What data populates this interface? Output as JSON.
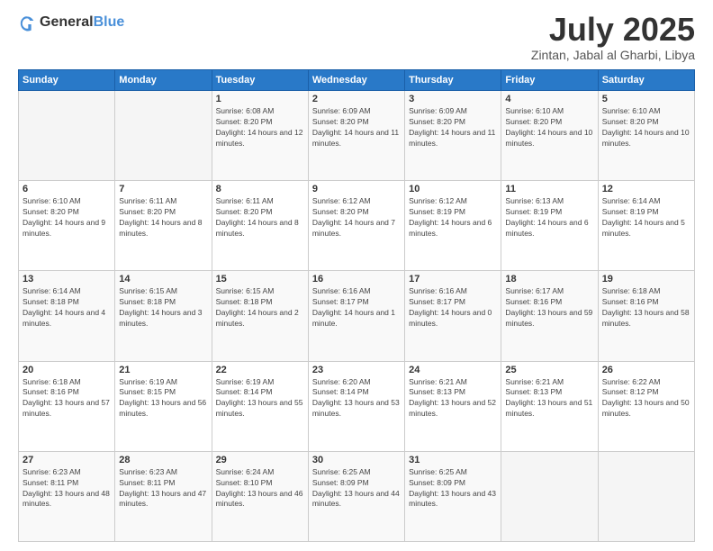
{
  "logo": {
    "general": "General",
    "blue": "Blue"
  },
  "title": {
    "month": "July 2025",
    "location": "Zintan, Jabal al Gharbi, Libya"
  },
  "header_days": [
    "Sunday",
    "Monday",
    "Tuesday",
    "Wednesday",
    "Thursday",
    "Friday",
    "Saturday"
  ],
  "weeks": [
    [
      {
        "day": "",
        "info": ""
      },
      {
        "day": "",
        "info": ""
      },
      {
        "day": "1",
        "info": "Sunrise: 6:08 AM\nSunset: 8:20 PM\nDaylight: 14 hours and 12 minutes."
      },
      {
        "day": "2",
        "info": "Sunrise: 6:09 AM\nSunset: 8:20 PM\nDaylight: 14 hours and 11 minutes."
      },
      {
        "day": "3",
        "info": "Sunrise: 6:09 AM\nSunset: 8:20 PM\nDaylight: 14 hours and 11 minutes."
      },
      {
        "day": "4",
        "info": "Sunrise: 6:10 AM\nSunset: 8:20 PM\nDaylight: 14 hours and 10 minutes."
      },
      {
        "day": "5",
        "info": "Sunrise: 6:10 AM\nSunset: 8:20 PM\nDaylight: 14 hours and 10 minutes."
      }
    ],
    [
      {
        "day": "6",
        "info": "Sunrise: 6:10 AM\nSunset: 8:20 PM\nDaylight: 14 hours and 9 minutes."
      },
      {
        "day": "7",
        "info": "Sunrise: 6:11 AM\nSunset: 8:20 PM\nDaylight: 14 hours and 8 minutes."
      },
      {
        "day": "8",
        "info": "Sunrise: 6:11 AM\nSunset: 8:20 PM\nDaylight: 14 hours and 8 minutes."
      },
      {
        "day": "9",
        "info": "Sunrise: 6:12 AM\nSunset: 8:20 PM\nDaylight: 14 hours and 7 minutes."
      },
      {
        "day": "10",
        "info": "Sunrise: 6:12 AM\nSunset: 8:19 PM\nDaylight: 14 hours and 6 minutes."
      },
      {
        "day": "11",
        "info": "Sunrise: 6:13 AM\nSunset: 8:19 PM\nDaylight: 14 hours and 6 minutes."
      },
      {
        "day": "12",
        "info": "Sunrise: 6:14 AM\nSunset: 8:19 PM\nDaylight: 14 hours and 5 minutes."
      }
    ],
    [
      {
        "day": "13",
        "info": "Sunrise: 6:14 AM\nSunset: 8:18 PM\nDaylight: 14 hours and 4 minutes."
      },
      {
        "day": "14",
        "info": "Sunrise: 6:15 AM\nSunset: 8:18 PM\nDaylight: 14 hours and 3 minutes."
      },
      {
        "day": "15",
        "info": "Sunrise: 6:15 AM\nSunset: 8:18 PM\nDaylight: 14 hours and 2 minutes."
      },
      {
        "day": "16",
        "info": "Sunrise: 6:16 AM\nSunset: 8:17 PM\nDaylight: 14 hours and 1 minute."
      },
      {
        "day": "17",
        "info": "Sunrise: 6:16 AM\nSunset: 8:17 PM\nDaylight: 14 hours and 0 minutes."
      },
      {
        "day": "18",
        "info": "Sunrise: 6:17 AM\nSunset: 8:16 PM\nDaylight: 13 hours and 59 minutes."
      },
      {
        "day": "19",
        "info": "Sunrise: 6:18 AM\nSunset: 8:16 PM\nDaylight: 13 hours and 58 minutes."
      }
    ],
    [
      {
        "day": "20",
        "info": "Sunrise: 6:18 AM\nSunset: 8:16 PM\nDaylight: 13 hours and 57 minutes."
      },
      {
        "day": "21",
        "info": "Sunrise: 6:19 AM\nSunset: 8:15 PM\nDaylight: 13 hours and 56 minutes."
      },
      {
        "day": "22",
        "info": "Sunrise: 6:19 AM\nSunset: 8:14 PM\nDaylight: 13 hours and 55 minutes."
      },
      {
        "day": "23",
        "info": "Sunrise: 6:20 AM\nSunset: 8:14 PM\nDaylight: 13 hours and 53 minutes."
      },
      {
        "day": "24",
        "info": "Sunrise: 6:21 AM\nSunset: 8:13 PM\nDaylight: 13 hours and 52 minutes."
      },
      {
        "day": "25",
        "info": "Sunrise: 6:21 AM\nSunset: 8:13 PM\nDaylight: 13 hours and 51 minutes."
      },
      {
        "day": "26",
        "info": "Sunrise: 6:22 AM\nSunset: 8:12 PM\nDaylight: 13 hours and 50 minutes."
      }
    ],
    [
      {
        "day": "27",
        "info": "Sunrise: 6:23 AM\nSunset: 8:11 PM\nDaylight: 13 hours and 48 minutes."
      },
      {
        "day": "28",
        "info": "Sunrise: 6:23 AM\nSunset: 8:11 PM\nDaylight: 13 hours and 47 minutes."
      },
      {
        "day": "29",
        "info": "Sunrise: 6:24 AM\nSunset: 8:10 PM\nDaylight: 13 hours and 46 minutes."
      },
      {
        "day": "30",
        "info": "Sunrise: 6:25 AM\nSunset: 8:09 PM\nDaylight: 13 hours and 44 minutes."
      },
      {
        "day": "31",
        "info": "Sunrise: 6:25 AM\nSunset: 8:09 PM\nDaylight: 13 hours and 43 minutes."
      },
      {
        "day": "",
        "info": ""
      },
      {
        "day": "",
        "info": ""
      }
    ]
  ]
}
